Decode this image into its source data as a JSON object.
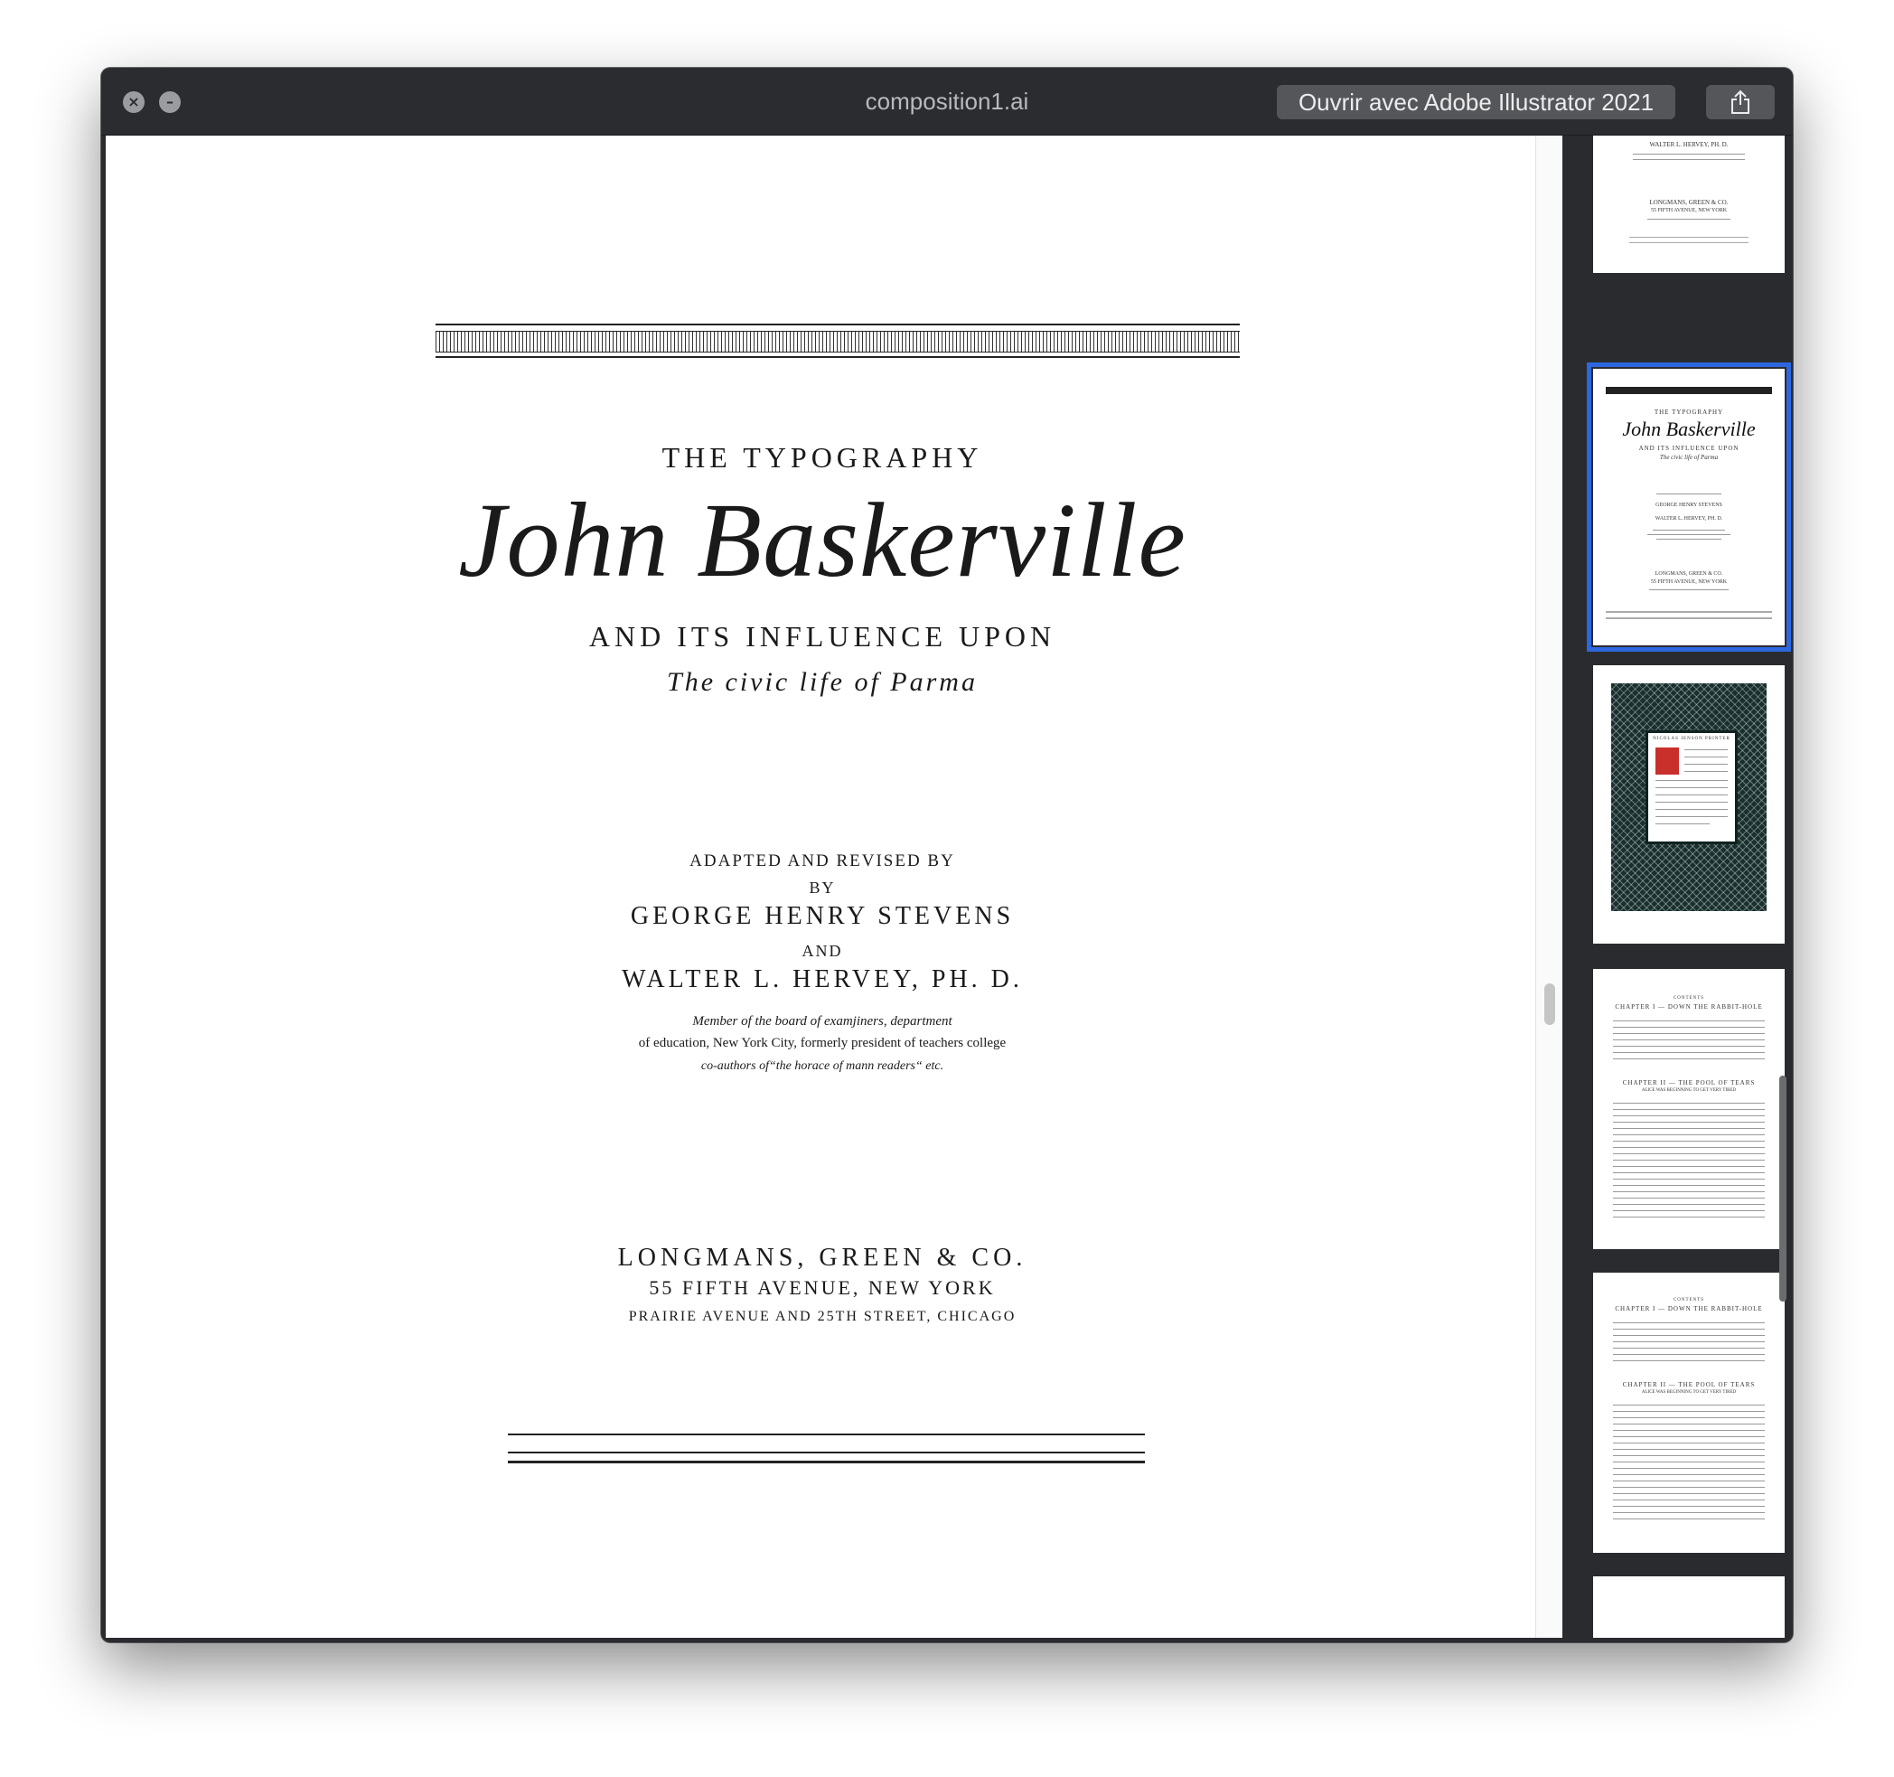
{
  "window": {
    "title": "composition1.ai",
    "open_with_label": "Ouvrir avec Adobe Illustrator 2021",
    "close_icon": "close-icon",
    "minimize_icon": "minimize-icon",
    "share_icon": "share-icon"
  },
  "title_page": {
    "line1": "THE TYPOGRAPHY",
    "main_title": "John Baskerville",
    "line2": "AND ITS INFLUENCE UPON",
    "subtitle": "The civic life of Parma",
    "adapted": "ADAPTED AND REVISED BY",
    "by": "BY",
    "author1": "GEORGE HENRY STEVENS",
    "and": "AND",
    "author2": "WALTER L. HERVEY, PH. D.",
    "desc1": "Member of the board of examjiners, department",
    "desc2": "of education, New York City, formerly president of teachers college",
    "desc3": "co-authors of“the horace of mann readers“ etc.",
    "publisher": "LONGMANS, GREEN & CO.",
    "address1": "55 FIFTH AVENUE, NEW YORK",
    "address2": "PRAIRIE AVENUE AND 25TH STREET, CHICAGO"
  },
  "thumbnails": [
    {
      "index": 1,
      "lines": [
        "WALTER L. HERVEY, PH. D.",
        "LONGMANS, GREEN & CO.",
        "55 FIFTH AVENUE, NEW YORK"
      ]
    },
    {
      "index": 2,
      "selected": true,
      "title": "John Baskerville",
      "lines": [
        "THE TYPOGRAPHY",
        "AND ITS INFLUENCE UPON",
        "The civic life of Parma",
        "GEORGE HENRY STEVENS",
        "WALTER L. HERVEY, PH. D.",
        "LONGMANS, GREEN & CO.",
        "55 FIFTH AVENUE, NEW YORK"
      ]
    },
    {
      "index": 3,
      "heading": "NICOLAS JENSON PRINTER",
      "colors": {
        "pattern": "#19302e",
        "initial": "#c9302c"
      }
    },
    {
      "index": 4,
      "heading": "CONTENTS",
      "chapter1": "CHAPTER I — DOWN THE RABBIT-HOLE",
      "chapter2": "CHAPTER II — THE POOL OF TEARS",
      "chapter2_sub": "ALICE WAS BEGINNING TO GET VERY TIRED"
    },
    {
      "index": 5,
      "heading": "CONTENTS",
      "chapter1": "CHAPTER I — DOWN THE RABBIT-HOLE",
      "chapter2": "CHAPTER II — THE POOL OF TEARS",
      "chapter2_sub": "ALICE WAS BEGINNING TO GET VERY TIRED"
    },
    {
      "index": 6
    }
  ],
  "colors": {
    "window_bg": "#2a2b2e",
    "selection": "#2d67e0",
    "button_bg": "#55565a"
  }
}
